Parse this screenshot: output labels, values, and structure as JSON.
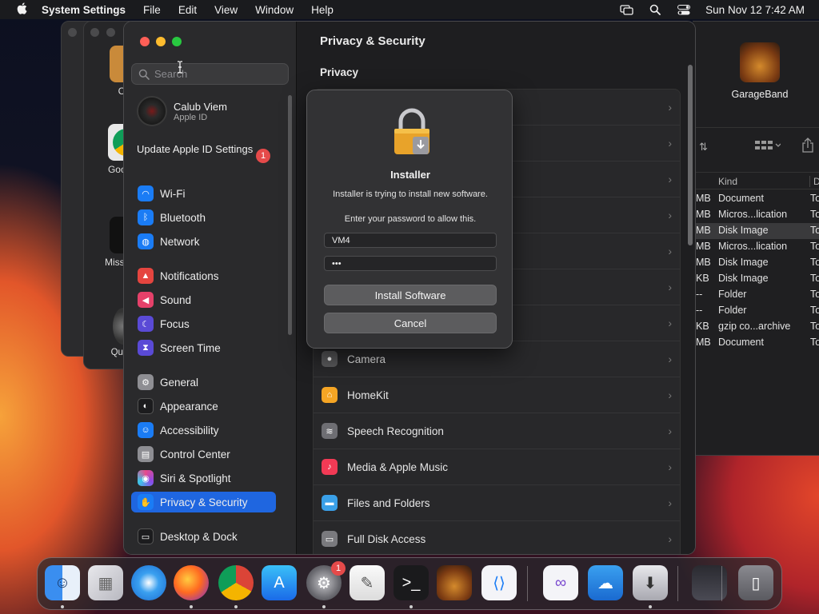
{
  "menubar": {
    "apple_icon": "apple-logo-icon",
    "app_name": "System Settings",
    "menus": [
      "File",
      "Edit",
      "View",
      "Window",
      "Help"
    ],
    "status_icons": [
      "screen-mirroring-icon",
      "spotlight-search-icon",
      "control-center-icon"
    ],
    "clock": "Sun Nov 12  7:42 AM"
  },
  "background_apps": {
    "left_labels": [
      "Co",
      "Googl",
      "Missio",
      "QuickT"
    ],
    "finder": {
      "app_label": "GarageBand",
      "columns": {
        "kind": "Kind",
        "date": "D"
      },
      "rows": [
        {
          "size": "MB",
          "kind": "Document",
          "date": "To"
        },
        {
          "size": "MB",
          "kind": "Micros...lication",
          "date": "To"
        },
        {
          "size": "MB",
          "kind": "Disk Image",
          "date": "To"
        },
        {
          "size": "MB",
          "kind": "Micros...lication",
          "date": "To"
        },
        {
          "size": "MB",
          "kind": "Disk Image",
          "date": "To"
        },
        {
          "size": "KB",
          "kind": "Disk Image",
          "date": "To"
        },
        {
          "size": "--",
          "kind": "Folder",
          "date": "To"
        },
        {
          "size": "--",
          "kind": "Folder",
          "date": "To"
        },
        {
          "size": "KB",
          "kind": "gzip co...archive",
          "date": "To"
        },
        {
          "size": "MB",
          "kind": "Document",
          "date": "To"
        }
      ]
    }
  },
  "sidebar": {
    "search_placeholder": "Search",
    "profile": {
      "name": "Calub Viem",
      "subtitle": "Apple ID"
    },
    "update": {
      "label": "Update Apple ID Settings",
      "badge": "1"
    },
    "items": [
      {
        "label": "Wi-Fi",
        "icon": "wifi-icon",
        "color": "#1a7cf5"
      },
      {
        "label": "Bluetooth",
        "icon": "bluetooth-icon",
        "color": "#1a7cf5"
      },
      {
        "label": "Network",
        "icon": "globe-icon",
        "color": "#1a7cf5"
      },
      {
        "label": "Notifications",
        "icon": "bell-icon",
        "color": "#e5453f"
      },
      {
        "label": "Sound",
        "icon": "speaker-icon",
        "color": "#e5416a"
      },
      {
        "label": "Focus",
        "icon": "moon-icon",
        "color": "#5a4ad6"
      },
      {
        "label": "Screen Time",
        "icon": "hourglass-icon",
        "color": "#5a4ad6"
      },
      {
        "label": "General",
        "icon": "gear-icon",
        "color": "#8e8e93"
      },
      {
        "label": "Appearance",
        "icon": "appearance-icon",
        "color": "#1c1c1e"
      },
      {
        "label": "Accessibility",
        "icon": "accessibility-icon",
        "color": "#1a7cf5"
      },
      {
        "label": "Control Center",
        "icon": "control-center-icon",
        "color": "#8e8e93"
      },
      {
        "label": "Siri & Spotlight",
        "icon": "siri-icon",
        "color": "#b03ad0"
      },
      {
        "label": "Privacy & Security",
        "icon": "hand-icon",
        "color": "#1a7cf5"
      },
      {
        "label": "Desktop & Dock",
        "icon": "dock-icon",
        "color": "#1c1c1e"
      }
    ]
  },
  "content": {
    "title": "Privacy & Security",
    "section": "Privacy",
    "rows": [
      {
        "label": "",
        "icon": ""
      },
      {
        "label": "",
        "icon": ""
      },
      {
        "label": "",
        "icon": ""
      },
      {
        "label": "",
        "icon": ""
      },
      {
        "label": "",
        "icon": ""
      },
      {
        "label": "",
        "icon": ""
      },
      {
        "label": "",
        "icon": ""
      },
      {
        "label": "Camera",
        "icon": "camera-icon",
        "color": "#5a5a5c"
      },
      {
        "label": "HomeKit",
        "icon": "home-icon",
        "color": "#f5a524"
      },
      {
        "label": "Speech Recognition",
        "icon": "waveform-icon",
        "color": "#6e6e73"
      },
      {
        "label": "Media & Apple Music",
        "icon": "music-note-icon",
        "color": "#f23a55"
      },
      {
        "label": "Files and Folders",
        "icon": "folder-icon",
        "color": "#3aa0e8"
      },
      {
        "label": "Full Disk Access",
        "icon": "disk-icon",
        "color": "#7a7a7e"
      }
    ]
  },
  "dialog": {
    "title": "Installer",
    "message": "Installer is trying to install new software.",
    "prompt": "Enter your password to allow this.",
    "username": "VM4",
    "password_dots": "•••",
    "primary_button": "Install Software",
    "cancel_button": "Cancel"
  },
  "dock": {
    "apps": [
      {
        "name": "Finder",
        "icon": "finder-icon",
        "running": true
      },
      {
        "name": "Launchpad",
        "icon": "launchpad-icon",
        "running": false
      },
      {
        "name": "Safari",
        "icon": "safari-icon",
        "running": false
      },
      {
        "name": "Firefox",
        "icon": "firefox-icon",
        "running": true
      },
      {
        "name": "Google Chrome",
        "icon": "chrome-icon",
        "running": true
      },
      {
        "name": "App Store",
        "icon": "app-store-icon",
        "running": false
      },
      {
        "name": "System Settings",
        "icon": "system-settings-icon",
        "running": true,
        "badge": "1"
      },
      {
        "name": "TextEdit",
        "icon": "textedit-icon",
        "running": false
      },
      {
        "name": "Terminal",
        "icon": "terminal-icon",
        "running": true
      },
      {
        "name": "GarageBand",
        "icon": "garageband-icon",
        "running": false
      },
      {
        "name": "Visual Studio Code",
        "icon": "vscode-icon",
        "running": false
      },
      {
        "name": "Visual Studio",
        "icon": "visual-studio-icon",
        "running": false
      },
      {
        "name": "Weather",
        "icon": "weather-icon",
        "running": false
      },
      {
        "name": "Installer",
        "icon": "installer-icon",
        "running": true
      },
      {
        "name": "Downloads",
        "icon": "downloads-stack-icon",
        "running": false
      },
      {
        "name": "Trash",
        "icon": "trash-icon",
        "running": false
      }
    ]
  }
}
